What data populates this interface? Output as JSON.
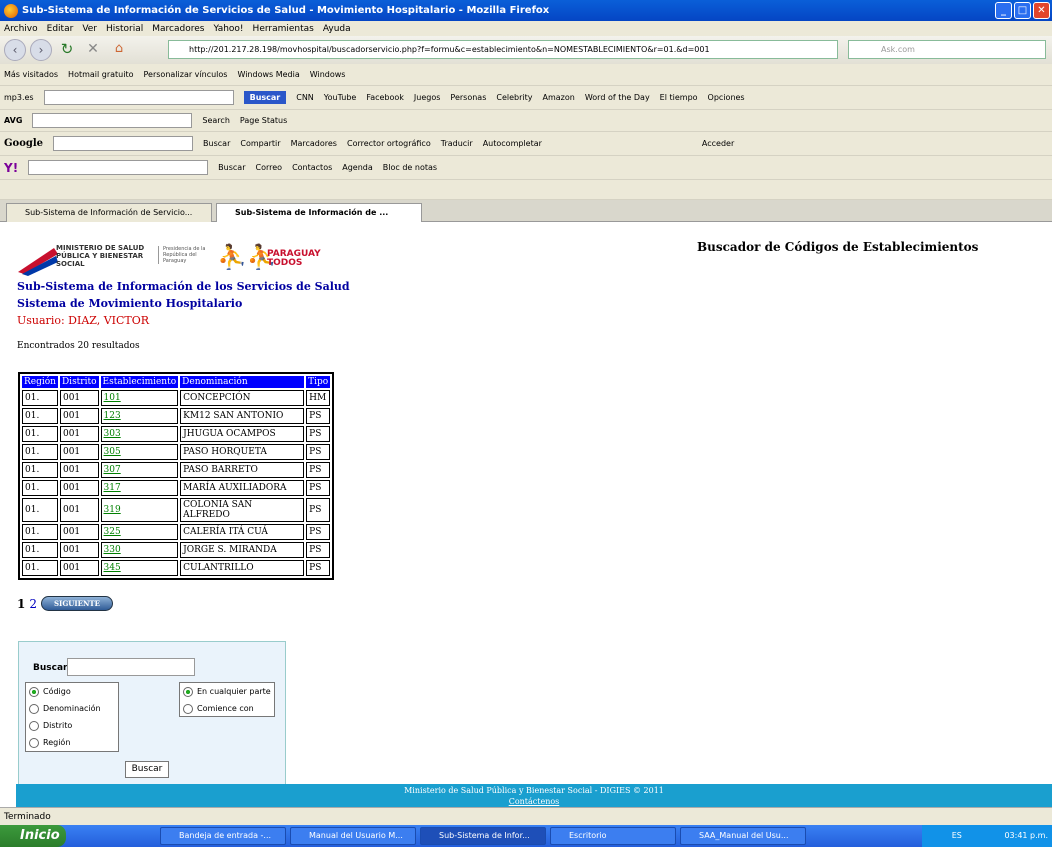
{
  "window": {
    "title": "Sub-Sistema de Información de Servicios de Salud - Movimiento Hospitalario - Mozilla Firefox"
  },
  "menu": [
    "Archivo",
    "Editar",
    "Ver",
    "Historial",
    "Marcadores",
    "Yahoo!",
    "Herramientas",
    "Ayuda"
  ],
  "nav": {
    "url": "http://201.217.28.198/movhospital/buscadorservicio.php?f=formu&c=establecimiento&n=NOMESTABLECIMIENTO&r=01.&d=001",
    "search_placeholder": "Ask.com"
  },
  "bookmarks": [
    "Más visitados",
    "Hotmail gratuito",
    "Personalizar vínculos",
    "Windows Media",
    "Windows"
  ],
  "toolbar_mp3": [
    "mp3.es",
    "Buscar",
    "CNN",
    "YouTube",
    "Facebook",
    "Juegos",
    "Personas",
    "Celebrity",
    "Amazon",
    "Word of the Day",
    "El tiempo",
    "Opciones"
  ],
  "toolbar_avg": [
    "AVG",
    "Search",
    "Page Status"
  ],
  "toolbar_google": [
    "Google",
    "Buscar",
    "Compartir",
    "Marcadores",
    "Corrector ortográfico",
    "Traducir",
    "Autocompletar",
    "Acceder"
  ],
  "toolbar_yahoo": [
    "Buscar",
    "Correo",
    "Contactos",
    "Agenda",
    "Bloc de notas"
  ],
  "tabs": [
    "Sub-Sistema de Información de Servicio...",
    "Sub-Sistema de Información de ..."
  ],
  "page": {
    "header_title": "Buscador de Códigos de Establecimientos",
    "ministry_logo": "MINISTERIO DE SALUD PÚBLICA Y BIENESTAR SOCIAL",
    "presidency": "Presidencia de la República del Paraguay",
    "paraguay_logo": "PARAGUAY TODOS",
    "subtitle1": "Sub-Sistema de Información de los Servicios de Salud",
    "subtitle2": "Sistema de Movimiento Hospitalario",
    "user_label": "Usuario:",
    "user_name": "DIAZ, VICTOR",
    "found": "Encontrados 20 resultados"
  },
  "table": {
    "headers": [
      "Región",
      "Distrito",
      "Establecimiento",
      "Denominación",
      "Tipo"
    ],
    "rows": [
      [
        "01.",
        "001",
        "101",
        "CONCEPCIÓN",
        "HM"
      ],
      [
        "01.",
        "001",
        "123",
        "KM12 SAN ANTONIO",
        "PS"
      ],
      [
        "01.",
        "001",
        "303",
        "JHUGUA OCAMPOS",
        "PS"
      ],
      [
        "01.",
        "001",
        "305",
        "PASO HORQUETA",
        "PS"
      ],
      [
        "01.",
        "001",
        "307",
        "PASO BARRETO",
        "PS"
      ],
      [
        "01.",
        "001",
        "317",
        "MARÍA AUXILIADORA",
        "PS"
      ],
      [
        "01.",
        "001",
        "319",
        "COLONIA SAN ALFREDO",
        "PS"
      ],
      [
        "01.",
        "001",
        "325",
        "CALERÍA ITÁ CUÁ",
        "PS"
      ],
      [
        "01.",
        "001",
        "330",
        "JORGE S. MIRANDA",
        "PS"
      ],
      [
        "01.",
        "001",
        "345",
        "CULANTRILLO",
        "PS"
      ]
    ]
  },
  "pager": {
    "current": "1",
    "next_page": "2",
    "next_label": "SIGUIENTE"
  },
  "search": {
    "label": "Buscar",
    "value": "",
    "field_options": [
      "Código",
      "Denominación",
      "Distrito",
      "Región"
    ],
    "field_selected": 0,
    "match_options": [
      "En cualquier parte",
      "Comience con"
    ],
    "match_selected": 0,
    "button": "Buscar"
  },
  "footer": {
    "text": "Ministerio de Salud Pública y Bienestar Social - DIGIES © 2011",
    "link": "Contáctenos"
  },
  "status": "Terminado",
  "taskbar": {
    "start": "Inicio",
    "tasks": [
      "Bandeja de entrada -...",
      "Manual del Usuario M...",
      "Sub-Sistema de Infor...",
      "Escritorio",
      "SAA_Manual del Usu..."
    ],
    "lang": "ES",
    "clock": "03:41 p.m."
  }
}
